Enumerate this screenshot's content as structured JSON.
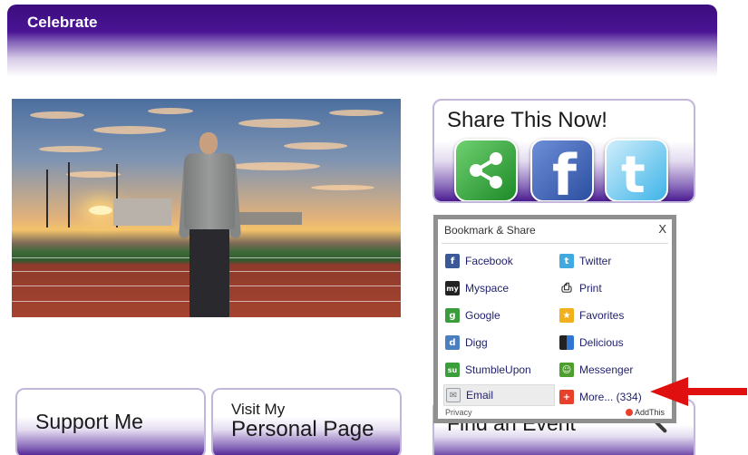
{
  "header": {
    "title": "Celebrate"
  },
  "buttons": {
    "support": "Support Me",
    "visit_line1": "Visit My",
    "visit_line2": "Personal Page",
    "find": "Find an Event"
  },
  "share": {
    "title": "Share This Now!",
    "icons": [
      "share-icon",
      "facebook-icon",
      "twitter-icon"
    ]
  },
  "popup": {
    "title": "Bookmark & Share",
    "close": "X",
    "services": [
      {
        "label": "Facebook",
        "icon": "facebook-icon",
        "color": "#3b5998"
      },
      {
        "label": "Twitter",
        "icon": "twitter-icon",
        "color": "#3fa9e0"
      },
      {
        "label": "Myspace",
        "icon": "myspace-icon",
        "color": "#222222"
      },
      {
        "label": "Print",
        "icon": "print-icon",
        "color": "#333333"
      },
      {
        "label": "Google",
        "icon": "google-icon",
        "color": "#3b9c3b"
      },
      {
        "label": "Favorites",
        "icon": "favorites-icon",
        "color": "#f2b01e"
      },
      {
        "label": "Digg",
        "icon": "digg-icon",
        "color": "#4a7fc0"
      },
      {
        "label": "Delicious",
        "icon": "delicious-icon",
        "color": "#3274d2"
      },
      {
        "label": "StumbleUpon",
        "icon": "stumbleupon-icon",
        "color": "#3a9e3a"
      },
      {
        "label": "Messenger",
        "icon": "messenger-icon",
        "color": "#4e9e2e"
      },
      {
        "label": "Email",
        "icon": "email-icon",
        "color": "#9aa0a8"
      },
      {
        "label": "More... (334)",
        "icon": "more-icon",
        "color": "#e8412b"
      }
    ],
    "footer_privacy": "Privacy",
    "footer_brand": "AddThis"
  }
}
